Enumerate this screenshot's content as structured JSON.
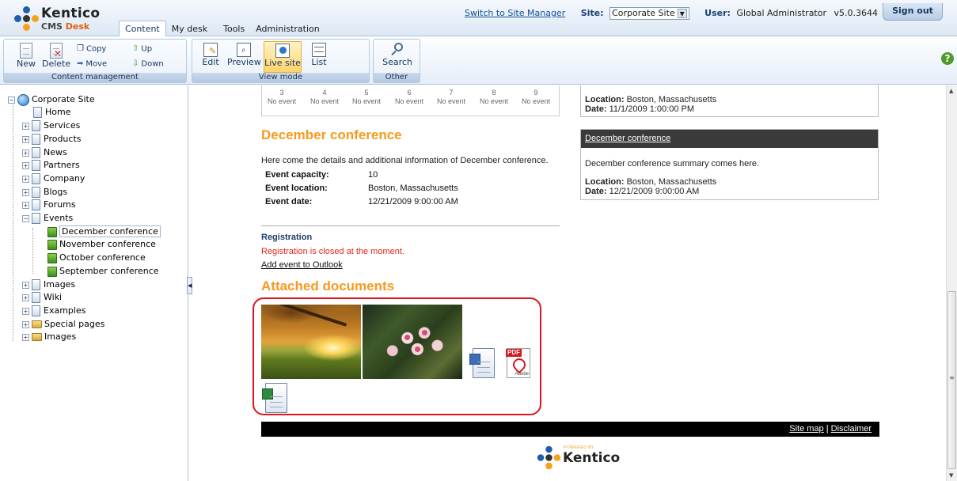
{
  "app": {
    "logo_name": "Kentico",
    "logo_sub_a": "CMS ",
    "logo_sub_b": "Desk",
    "switch_link": "Switch to Site Manager",
    "site_label": "Site:",
    "site_value": "Corporate Site",
    "user_label": "User:",
    "user_value": "Global Administrator",
    "version": "v5.0.3644",
    "sign_out": "Sign out"
  },
  "tabs": [
    {
      "label": "Content",
      "active": true
    },
    {
      "label": "My desk"
    },
    {
      "label": "Tools"
    },
    {
      "label": "Administration"
    }
  ],
  "toolbar": {
    "content_group": "Content management",
    "new": "New",
    "delete": "Delete",
    "copy": "Copy",
    "move": "Move",
    "up": "Up",
    "down": "Down",
    "view_group": "View mode",
    "edit": "Edit",
    "preview": "Preview",
    "live_site": "Live site",
    "list": "List",
    "other_group": "Other",
    "search": "Search"
  },
  "tree": {
    "root": "Corporate Site",
    "items": [
      "Home",
      "Services",
      "Products",
      "News",
      "Partners",
      "Company",
      "Blogs",
      "Forums",
      "Events"
    ],
    "events": [
      "December conference",
      "November conference",
      "October conference",
      "September conference"
    ],
    "after": [
      "Images",
      "Wiki",
      "Examples",
      "Special pages",
      "Images"
    ]
  },
  "calendar": {
    "days": [
      "3",
      "4",
      "5",
      "6",
      "7",
      "8",
      "9"
    ],
    "no_event": "No event"
  },
  "event": {
    "title": "December conference",
    "intro": "Here come the details and additional information of December conference.",
    "capacity_label": "Event capacity:",
    "capacity": "10",
    "location_label": "Event location:",
    "location": "Boston, Massachusetts",
    "date_label": "Event date:",
    "date": "12/21/2009 9:00:00 AM",
    "registration_heading": "Registration",
    "registration_closed": "Registration is closed at the moment.",
    "add_outlook": "Add event to Outlook",
    "attached_heading": "Attached documents"
  },
  "sidebar_panels": {
    "prev_location_label": "Location:",
    "prev_location": "Boston, Massachusetts",
    "prev_date_label": "Date:",
    "prev_date": "11/1/2009 1:00:00 PM",
    "panel_title": "December conference",
    "panel_summary": "December conference summary comes here.",
    "location_label": "Location:",
    "location": "Boston, Massachusetts",
    "date_label": "Date:",
    "date": "12/21/2009 9:00:00 AM"
  },
  "footer": {
    "site_map": "Site map",
    "separator": "|",
    "disclaimer": "Disclaimer",
    "powered_by": "POWERED BY",
    "powered_name": "Kentico"
  },
  "colors": {
    "accent_orange": "#f79a1c",
    "registration_red": "#e2261c",
    "highlight_box": "#e1141c"
  },
  "help": "?"
}
